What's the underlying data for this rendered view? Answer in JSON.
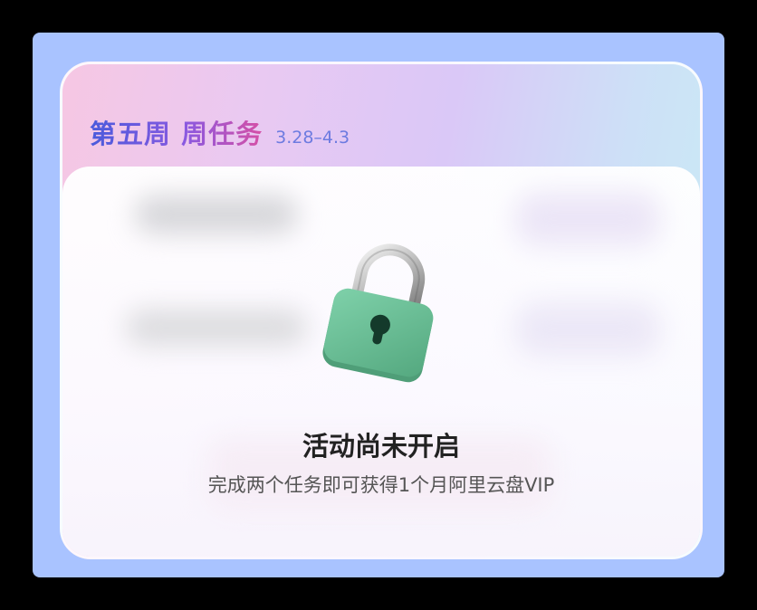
{
  "card": {
    "title": "第五周 周任务",
    "date_range": "3.28–4.3"
  },
  "locked_state": {
    "icon": "lock-icon",
    "heading": "活动尚未开启",
    "description": "完成两个任务即可获得1个月阿里云盘VIP"
  },
  "colors": {
    "frame_bg": "#a9c3ff",
    "lock_green": "#6fc49a",
    "title_gradient_start": "#4a5bdc",
    "title_gradient_end": "#d64fa5",
    "date_color": "#6d7be0"
  }
}
